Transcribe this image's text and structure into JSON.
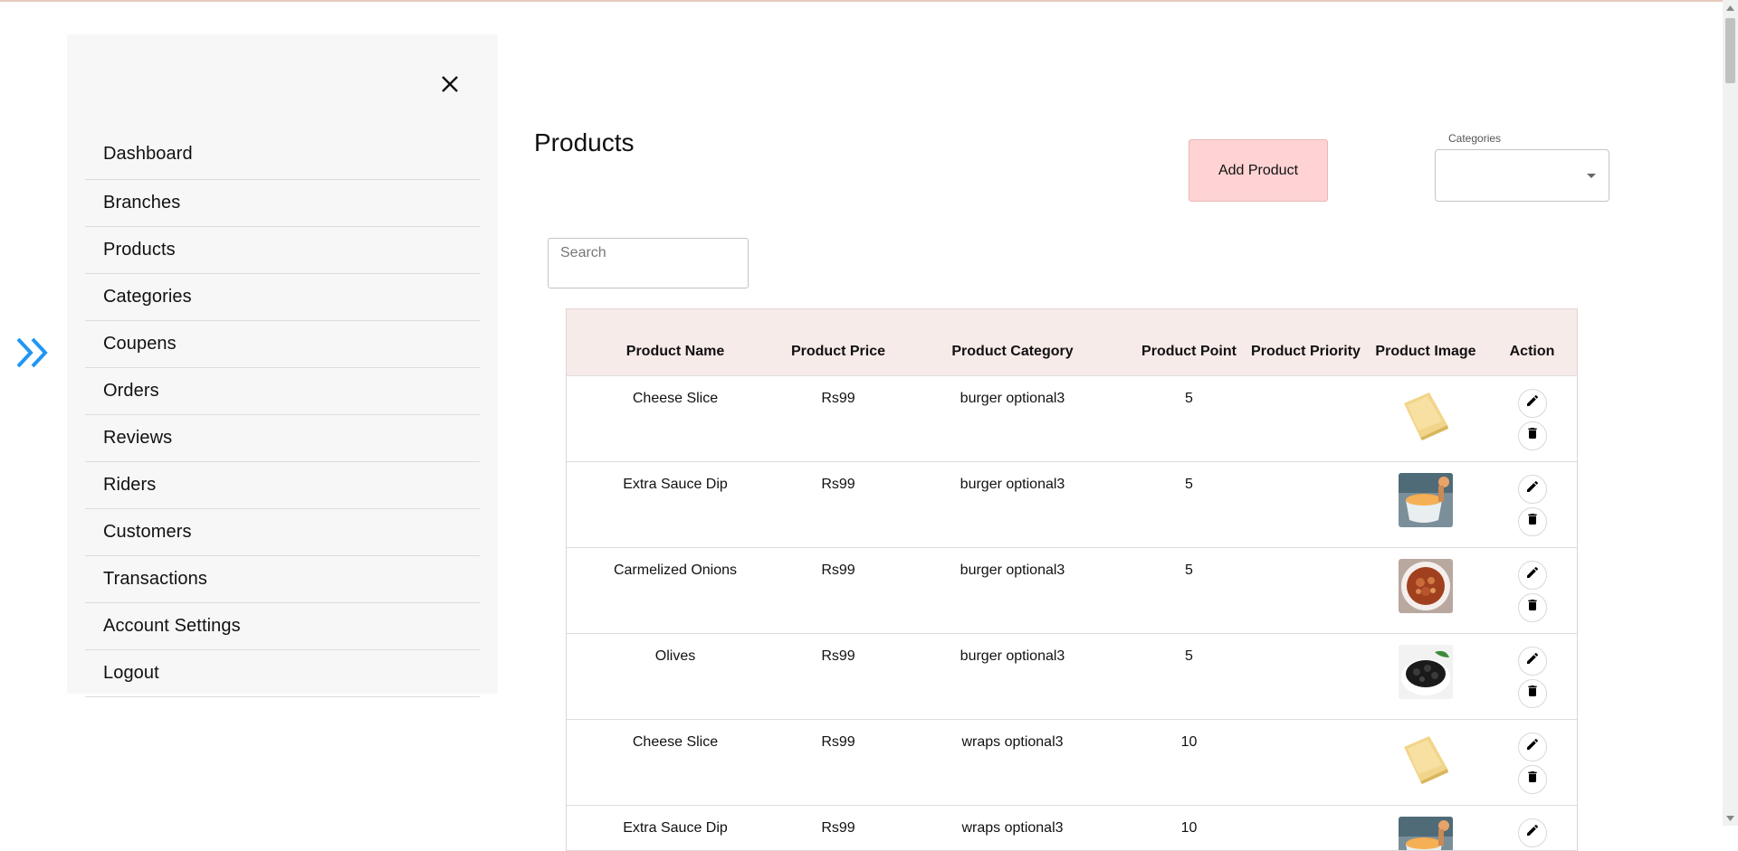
{
  "sidebar": {
    "items": [
      {
        "label": "Dashboard"
      },
      {
        "label": "Branches"
      },
      {
        "label": "Products"
      },
      {
        "label": "Categories"
      },
      {
        "label": "Coupens"
      },
      {
        "label": "Orders"
      },
      {
        "label": "Reviews"
      },
      {
        "label": "Riders"
      },
      {
        "label": "Customers"
      },
      {
        "label": "Transactions"
      },
      {
        "label": "Account Settings"
      },
      {
        "label": "Logout"
      }
    ],
    "close_icon": "close-icon",
    "expand_icon": "double-chevron-right-icon"
  },
  "header": {
    "title": "Products",
    "add_button": "Add Product",
    "categories_label": "Categories",
    "categories_value": ""
  },
  "search": {
    "placeholder": "Search",
    "value": ""
  },
  "table": {
    "columns": [
      "Product Name",
      "Product Price",
      "Product Category",
      "Product Point",
      "Product Priority",
      "Product Image",
      "Action"
    ],
    "rows": [
      {
        "name": "Cheese Slice",
        "price": "Rs99",
        "category": "burger optional3",
        "point": "5",
        "priority": "",
        "image": "cheese-slice-image"
      },
      {
        "name": "Extra Sauce Dip",
        "price": "Rs99",
        "category": "burger optional3",
        "point": "5",
        "priority": "",
        "image": "sauce-dip-image"
      },
      {
        "name": "Carmelized Onions",
        "price": "Rs99",
        "category": "burger optional3",
        "point": "5",
        "priority": "",
        "image": "onions-image"
      },
      {
        "name": "Olives",
        "price": "Rs99",
        "category": "burger optional3",
        "point": "5",
        "priority": "",
        "image": "olives-image"
      },
      {
        "name": "Cheese Slice",
        "price": "Rs99",
        "category": "wraps optional3",
        "point": "10",
        "priority": "",
        "image": "cheese-slice-image"
      },
      {
        "name": "Extra Sauce Dip",
        "price": "Rs99",
        "category": "wraps optional3",
        "point": "10",
        "priority": "",
        "image": "sauce-dip-image"
      }
    ]
  },
  "colors": {
    "accent": "#2196f3",
    "add_button_bg": "#ffd3d3",
    "table_header_bg": "#f7ebea",
    "sidebar_bg": "#f7f7f7"
  }
}
